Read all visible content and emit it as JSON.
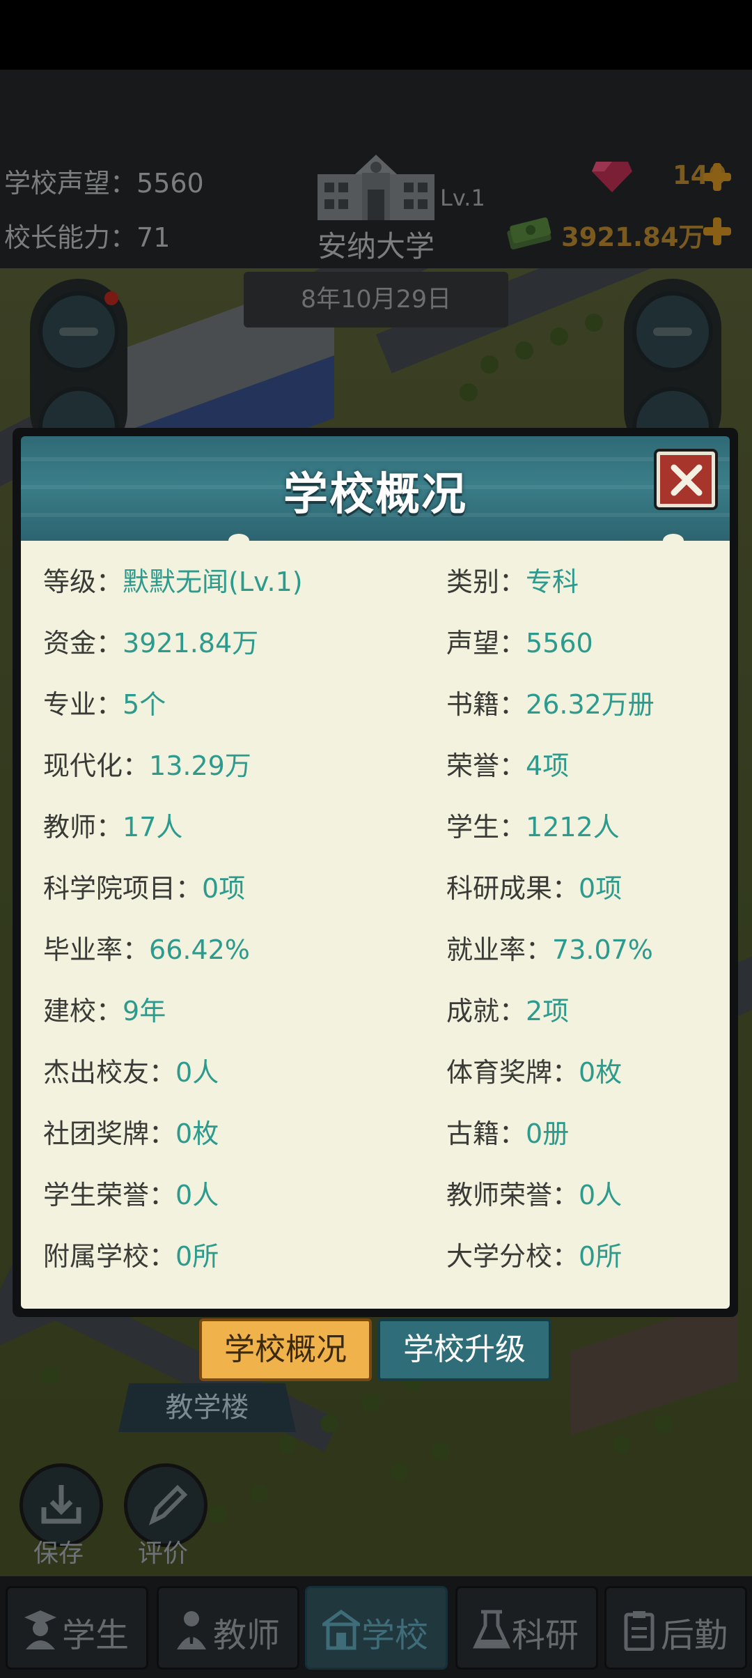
{
  "hud": {
    "reputation_label": "学校声望：",
    "reputation_value": "5560",
    "ability_label": "校长能力：",
    "ability_value": "71",
    "school_name": "安纳大学",
    "level": "Lv.1",
    "gems": "140",
    "money": "3921.84万",
    "date": "8年10月29日"
  },
  "dialog": {
    "title": "学校概况",
    "left": [
      {
        "key": "等级：",
        "value": "默默无闻(Lv.1)"
      },
      {
        "key": "资金：",
        "value": "3921.84万"
      },
      {
        "key": "专业：",
        "value": "5个"
      },
      {
        "key": "现代化：",
        "value": "13.29万"
      },
      {
        "key": "教师：",
        "value": "17人"
      },
      {
        "key": "科学院项目：",
        "value": "0项"
      },
      {
        "key": "毕业率：",
        "value": "66.42%"
      },
      {
        "key": "建校：",
        "value": "9年"
      },
      {
        "key": "杰出校友：",
        "value": "0人"
      },
      {
        "key": "社团奖牌：",
        "value": "0枚"
      },
      {
        "key": "学生荣誉：",
        "value": "0人"
      },
      {
        "key": "附属学校：",
        "value": "0所"
      }
    ],
    "right": [
      {
        "key": "类别：",
        "value": "专科"
      },
      {
        "key": "声望：",
        "value": "5560"
      },
      {
        "key": "书籍：",
        "value": "26.32万册"
      },
      {
        "key": "荣誉：",
        "value": "4项"
      },
      {
        "key": "学生：",
        "value": "1212人"
      },
      {
        "key": "科研成果：",
        "value": "0项"
      },
      {
        "key": "就业率：",
        "value": "73.07%"
      },
      {
        "key": "成就：",
        "value": "2项"
      },
      {
        "key": "体育奖牌：",
        "value": "0枚"
      },
      {
        "key": "古籍：",
        "value": "0册"
      },
      {
        "key": "教师荣誉：",
        "value": "0人"
      },
      {
        "key": "大学分校：",
        "value": "0所"
      }
    ]
  },
  "tabs": {
    "overview": "学校概况",
    "upgrade": "学校升级"
  },
  "building_label": "教学楼",
  "actions": {
    "save": "保存",
    "review": "评价"
  },
  "nav": {
    "students": "学生",
    "teachers": "教师",
    "school": "学校",
    "research": "科研",
    "logistics": "后勤"
  }
}
